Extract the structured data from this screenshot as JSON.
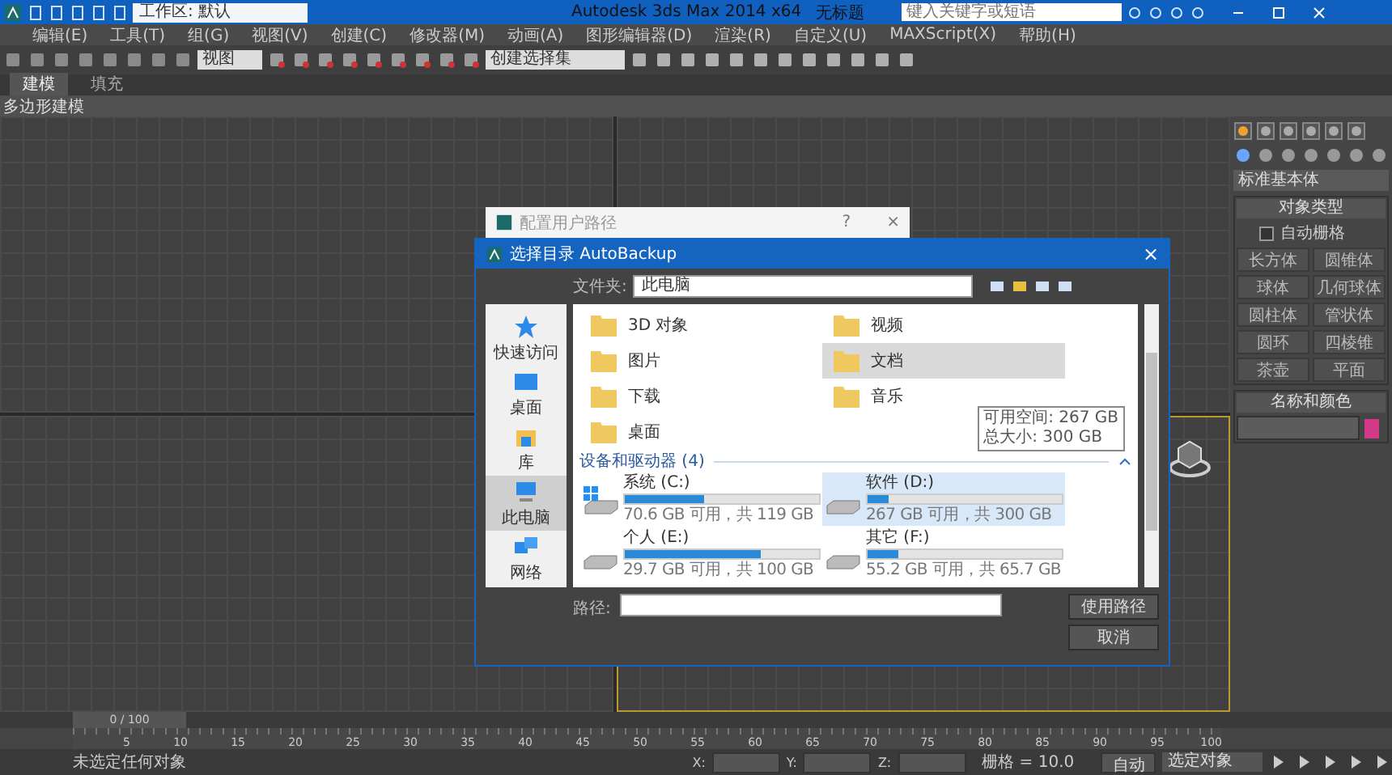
{
  "title_bar": {
    "workspace": "工作区: 默认",
    "title": "Autodesk 3ds Max  2014 x64",
    "document": "无标题",
    "search": {
      "placeholder": "键入关键字或短语"
    }
  },
  "menu": [
    "编辑(E)",
    "工具(T)",
    "组(G)",
    "视图(V)",
    "创建(C)",
    "修改器(M)",
    "动画(A)",
    "图形编辑器(D)",
    "渲染(R)",
    "自定义(U)",
    "MAXScript(X)",
    "帮助(H)"
  ],
  "toolbar": {
    "view_dropdown": "视图",
    "selection_set": "创建选择集"
  },
  "ribbon": {
    "tabs": [
      {
        "label": "建模",
        "selected": true
      },
      {
        "label": "填充",
        "selected": false
      }
    ],
    "panel": "多边形建模"
  },
  "command_panel": {
    "category": "标准基本体",
    "object_type": "对象类型",
    "autogrid": {
      "label": "自动栅格",
      "checked": false
    },
    "buttons": [
      "长方体",
      "圆锥体",
      "球体",
      "几何球体",
      "圆柱体",
      "管状体",
      "圆环",
      "四棱锥",
      "茶壶",
      "平面"
    ],
    "name_color": "名称和颜色"
  },
  "back_dialog": {
    "title": "配置用户路径",
    "help": "?",
    "close": "×"
  },
  "dialog": {
    "title": "选择目录 AutoBackup",
    "close": "×",
    "folder_label": "文件夹:",
    "folder_value": "此电脑",
    "nav": [
      {
        "label": "快速访问",
        "selected": false
      },
      {
        "label": "桌面",
        "selected": false
      },
      {
        "label": "库",
        "selected": false
      },
      {
        "label": "此电脑",
        "selected": true
      },
      {
        "label": "网络",
        "selected": false
      }
    ],
    "folders": [
      {
        "label": "3D 对象",
        "selected": false
      },
      {
        "label": "视频",
        "selected": false
      },
      {
        "label": "图片",
        "selected": false
      },
      {
        "label": "文档",
        "selected": true
      },
      {
        "label": "下载",
        "selected": false
      },
      {
        "label": "音乐",
        "selected": false
      },
      {
        "label": "桌面",
        "selected": false
      }
    ],
    "section": "设备和驱动器 (4)",
    "drives": [
      {
        "kind": "system",
        "name": "系统 (C:)",
        "level": 0.41,
        "caption": "70.6 GB 可用，共 119 GB",
        "selected": false
      },
      {
        "kind": "disk",
        "name": "软件 (D:)",
        "level": 0.11,
        "caption": "267 GB 可用，共 300 GB",
        "selected": true
      },
      {
        "kind": "disk",
        "name": "个人 (E:)",
        "level": 0.7,
        "caption": "29.7 GB 可用，共 100 GB",
        "selected": false
      },
      {
        "kind": "disk",
        "name": "其它 (F:)",
        "level": 0.16,
        "caption": "55.2 GB 可用，共 65.7 GB",
        "selected": false
      }
    ],
    "tooltip": [
      "可用空间: 267 GB",
      "总大小: 300 GB"
    ],
    "path_label": "路径:",
    "buttons": [
      "使用路径",
      "取消"
    ]
  },
  "timeline": {
    "position": "0 / 100",
    "ticks": [
      "5",
      "10",
      "15",
      "20",
      "25",
      "30",
      "35",
      "40",
      "45",
      "50",
      "55",
      "60",
      "65",
      "70",
      "75",
      "80",
      "85",
      "90",
      "95",
      "100"
    ]
  },
  "status_bar": {
    "message": "未选定任何对象",
    "coords": [
      "X:",
      "Y:",
      "Z:"
    ],
    "grid": "栅格 = 10.0",
    "auto_key": "自动",
    "selection": "选定对象"
  }
}
